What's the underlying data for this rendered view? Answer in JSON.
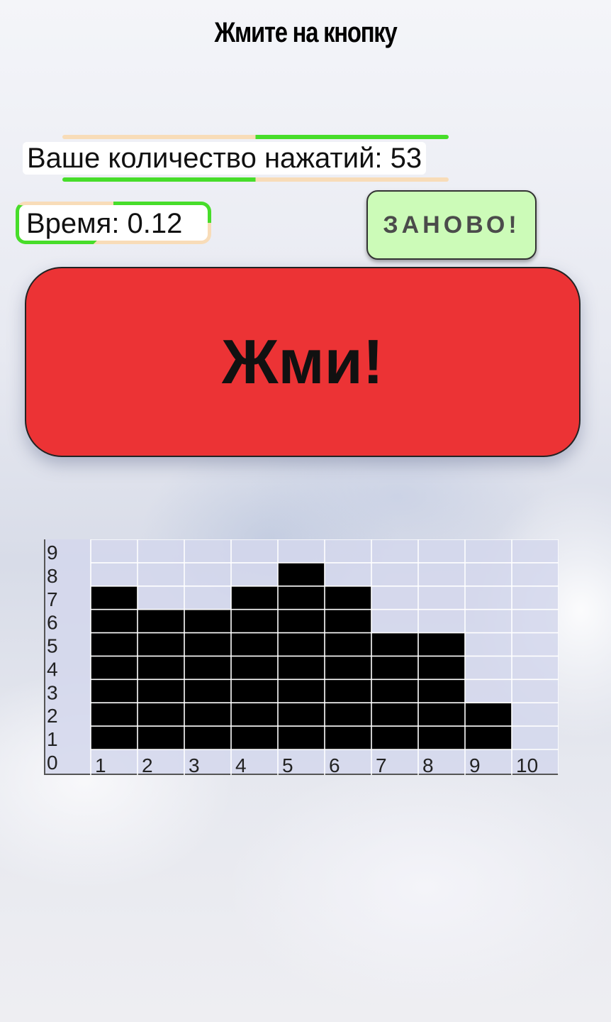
{
  "header": {
    "title": "Жмите на кнопку"
  },
  "stats": {
    "count_label": "Ваше количество нажатий: 53",
    "time_label": "Время: 0.12"
  },
  "buttons": {
    "restart_label": "ЗАНОВО!",
    "press_label": "Жми!"
  },
  "colors": {
    "press_button": "#ec3335",
    "restart_button": "#ccfbb8",
    "progress_green": "#47dd2a",
    "progress_peach": "#f8dcb8",
    "bars": "#000000"
  },
  "chart_data": {
    "type": "bar",
    "categories": [
      "1",
      "2",
      "3",
      "4",
      "5",
      "6",
      "7",
      "8",
      "9",
      "10"
    ],
    "values": [
      7,
      6,
      6,
      7,
      8,
      7,
      5,
      5,
      2,
      0
    ],
    "x_ticks": [
      "1",
      "2",
      "3",
      "4",
      "5",
      "6",
      "7",
      "8",
      "9",
      "10"
    ],
    "y_ticks": [
      "0",
      "1",
      "2",
      "3",
      "4",
      "5",
      "6",
      "7",
      "8",
      "9"
    ],
    "ylim": [
      0,
      9
    ],
    "grid": true
  }
}
